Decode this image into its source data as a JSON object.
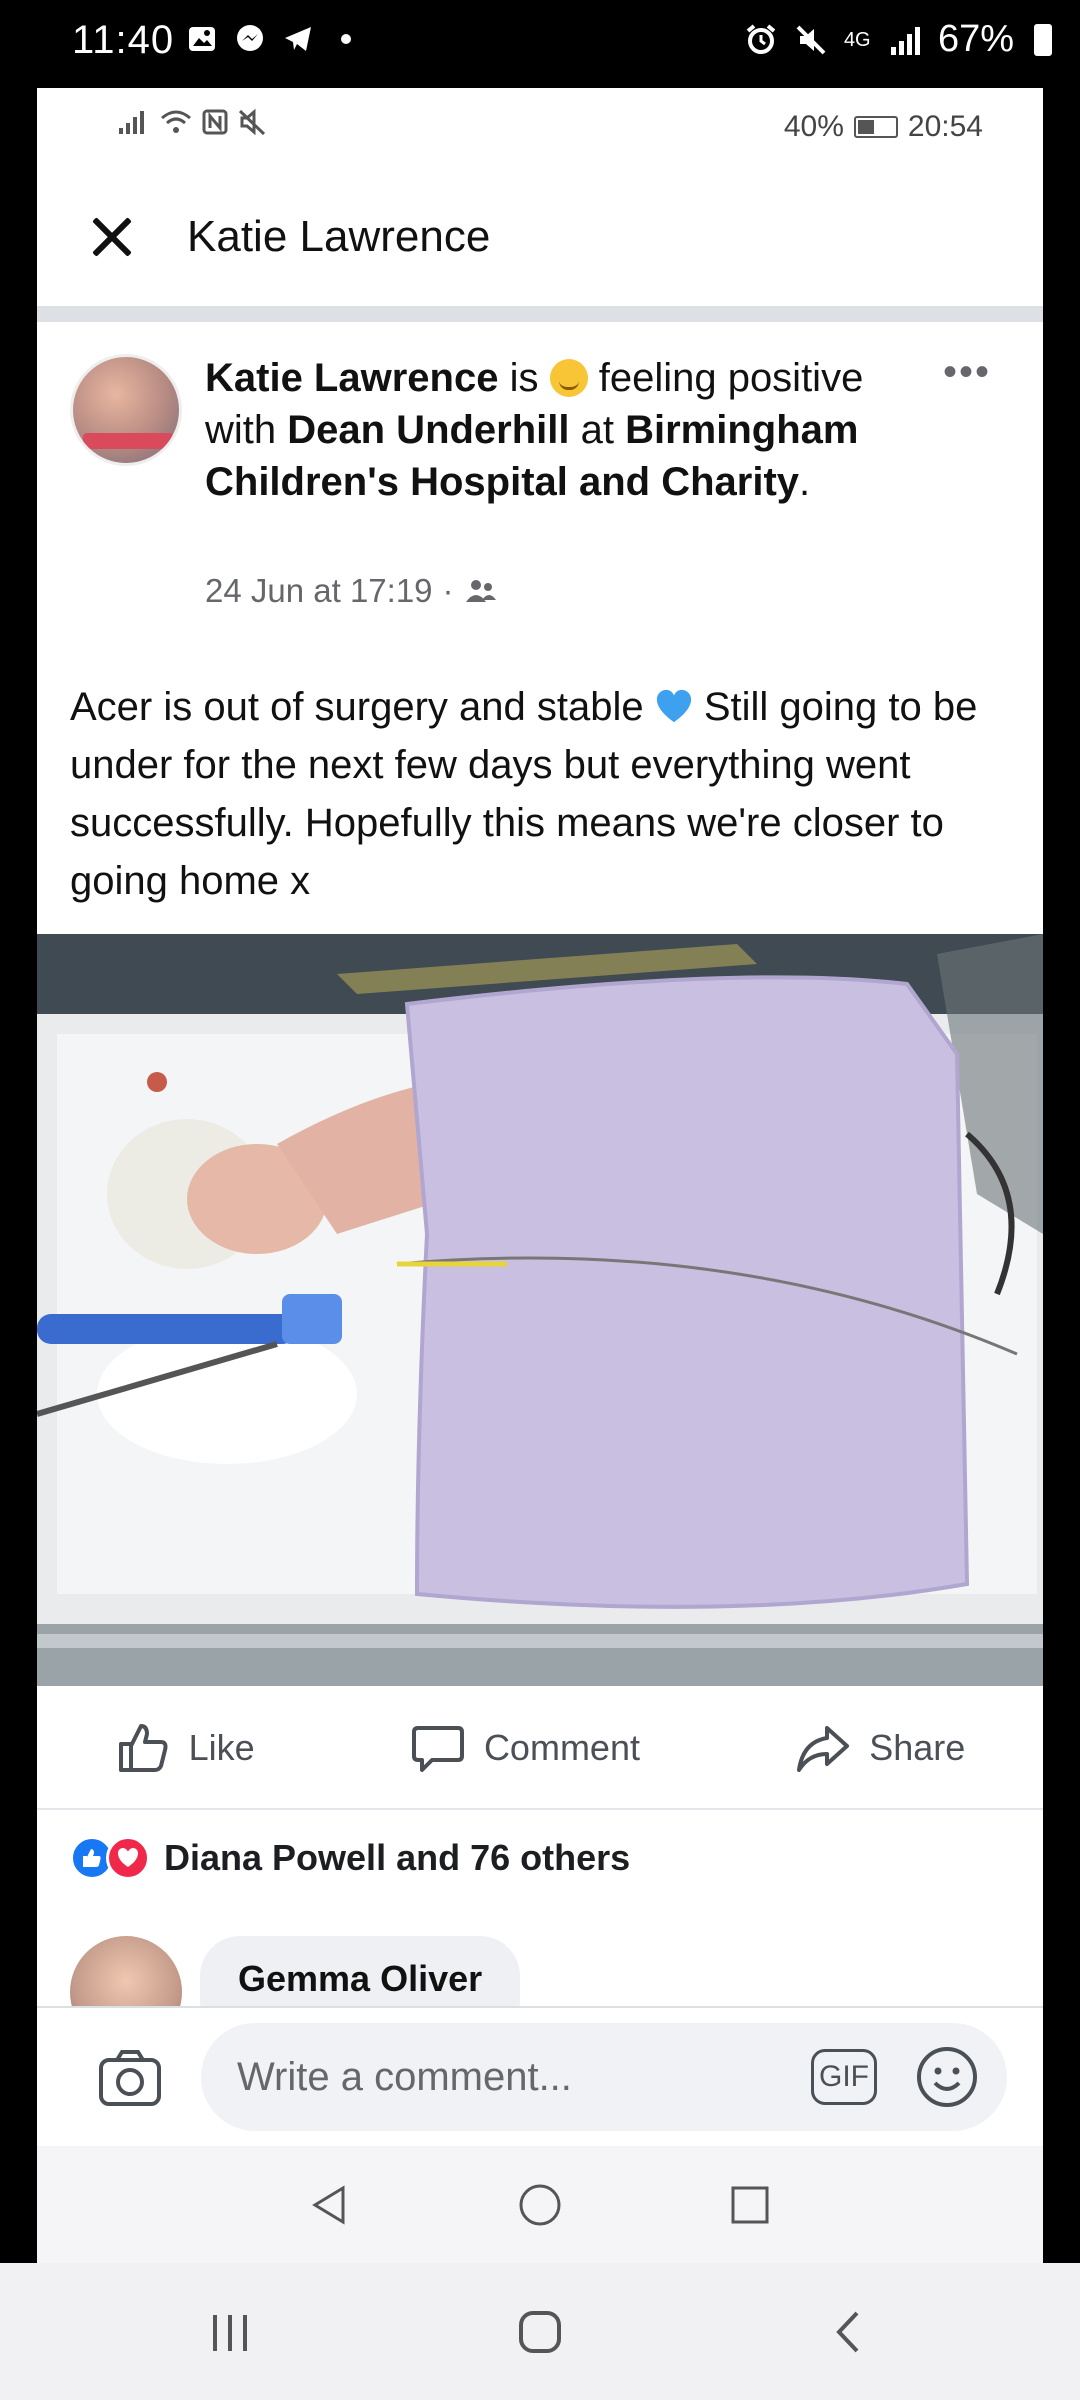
{
  "device_status": {
    "time": "11:40",
    "network": "4G",
    "battery": "67%"
  },
  "inner_status": {
    "battery": "40%",
    "time": "20:54"
  },
  "header": {
    "title": "Katie Lawrence"
  },
  "post": {
    "author": "Katie Lawrence",
    "is_text": " is ",
    "feeling": " feeling positive with ",
    "tagged": "Dean Underhill",
    "at_text": " at ",
    "place": "Birmingham Children's Hospital and Charity",
    "period": ".",
    "timestamp": "24 Jun at 17:19",
    "dot": "·",
    "more": "•••",
    "body_part1": "Acer is out of surgery and stable ",
    "body_part2": " Still going to be under for the next few days but everything went successfully. Hopefully this means we're closer to going home x"
  },
  "actions": {
    "like": "Like",
    "comment": "Comment",
    "share": "Share"
  },
  "reactions": {
    "summary": "Diana Powell and 76 others"
  },
  "comments": [
    {
      "author": "Gemma Oliver"
    }
  ],
  "comment_bar": {
    "placeholder": "Write a comment...",
    "gif": "GIF"
  }
}
